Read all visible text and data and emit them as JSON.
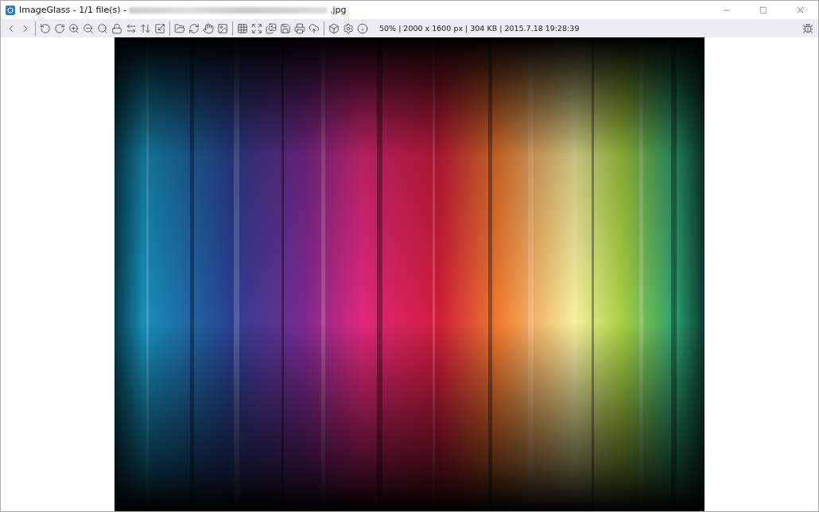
{
  "window": {
    "title": "ImageGlass - 1/1 file(s) -",
    "title_suffix": ".jpg"
  },
  "toolbar": {
    "status": "50% | 2000 x 1600 px | 304 KB | 2015.7.18 19:28:39"
  }
}
